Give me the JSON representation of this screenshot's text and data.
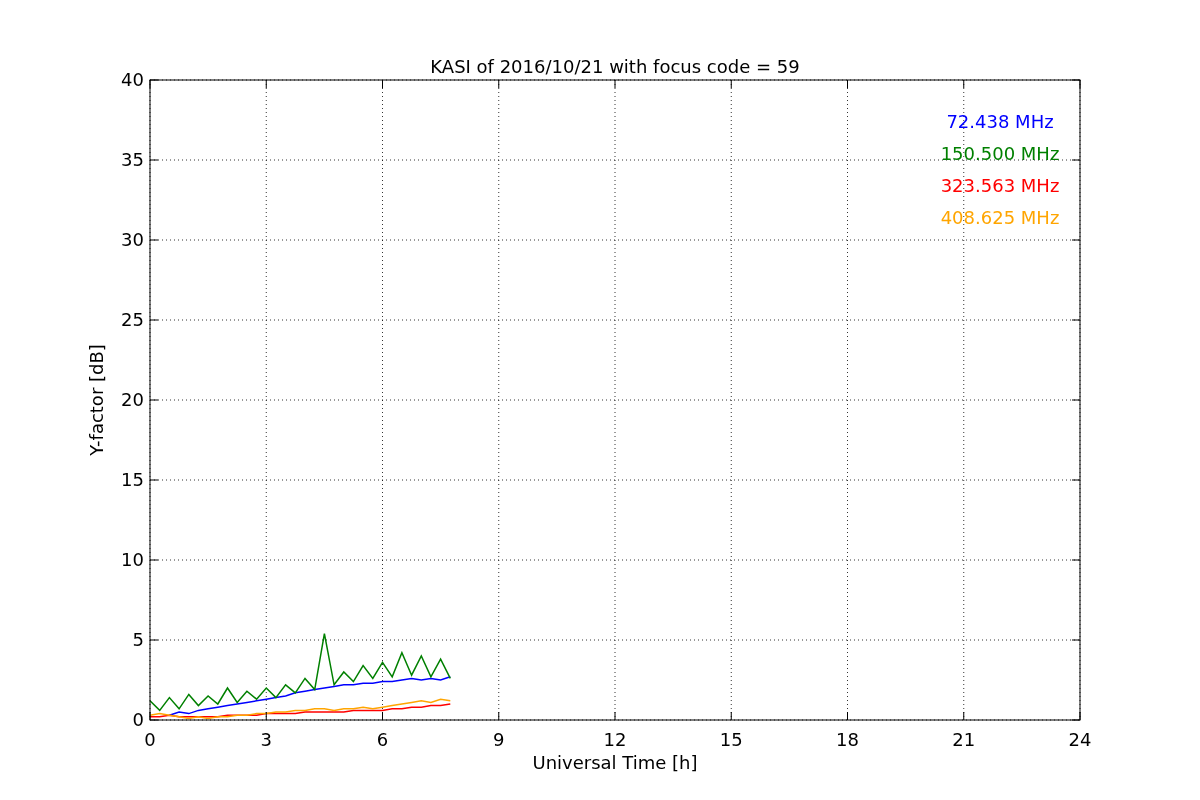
{
  "figure": {
    "chart_data": {
      "type": "line",
      "title": "KASI of 2016/10/21 with focus code = 59",
      "xlabel": "Universal Time [h]",
      "ylabel": "Y-factor [dB]",
      "x": [
        0,
        0.25,
        0.5,
        0.75,
        1,
        1.25,
        1.5,
        1.75,
        2,
        2.25,
        2.5,
        2.75,
        3,
        3.25,
        3.5,
        3.75,
        4,
        4.25,
        4.5,
        4.75,
        5,
        5.25,
        5.5,
        5.75,
        6,
        6.25,
        6.5,
        6.75,
        7,
        7.25,
        7.5,
        7.75
      ],
      "series": [
        {
          "name": "72.438 MHz",
          "color": "#0000ff",
          "values": [
            null,
            null,
            0.3,
            0.5,
            0.4,
            0.6,
            0.7,
            0.8,
            0.9,
            1.0,
            1.1,
            1.2,
            1.3,
            1.4,
            1.5,
            1.7,
            1.8,
            1.9,
            2.0,
            2.1,
            2.2,
            2.2,
            2.3,
            2.3,
            2.4,
            2.4,
            2.5,
            2.6,
            2.5,
            2.6,
            2.5,
            2.7
          ]
        },
        {
          "name": "150.500 MHz",
          "color": "#008000",
          "values": [
            1.2,
            0.6,
            1.4,
            0.7,
            1.6,
            0.9,
            1.5,
            1.0,
            2.0,
            1.1,
            1.8,
            1.3,
            2.0,
            1.4,
            2.2,
            1.7,
            2.6,
            1.9,
            5.4,
            2.2,
            3.0,
            2.4,
            3.4,
            2.6,
            3.6,
            2.7,
            4.2,
            2.8,
            4.0,
            2.7,
            3.8,
            2.6
          ]
        },
        {
          "name": "323.563 MHz",
          "color": "#ff0000",
          "values": [
            0.2,
            0.2,
            0.3,
            0.2,
            0.2,
            0.2,
            0.2,
            0.2,
            0.3,
            0.3,
            0.3,
            0.3,
            0.4,
            0.4,
            0.4,
            0.4,
            0.5,
            0.5,
            0.5,
            0.5,
            0.5,
            0.6,
            0.6,
            0.6,
            0.6,
            0.7,
            0.7,
            0.8,
            0.8,
            0.9,
            0.9,
            1.0
          ]
        },
        {
          "name": "408.625 MHz",
          "color": "#ffa500",
          "values": [
            0.3,
            0.4,
            0.3,
            0.2,
            0.1,
            0.2,
            0.1,
            0.2,
            0.2,
            0.3,
            0.3,
            0.4,
            0.4,
            0.5,
            0.5,
            0.6,
            0.6,
            0.7,
            0.7,
            0.6,
            0.7,
            0.7,
            0.8,
            0.7,
            0.8,
            0.9,
            1.0,
            1.1,
            1.2,
            1.1,
            1.3,
            1.2
          ]
        }
      ],
      "grid": true,
      "xlim": [
        0,
        24
      ],
      "ylim": [
        0,
        40
      ],
      "xticks": [
        0,
        3,
        6,
        9,
        12,
        15,
        18,
        21,
        24
      ],
      "yticks": [
        0,
        5,
        10,
        15,
        20,
        25,
        30,
        35,
        40
      ]
    }
  }
}
